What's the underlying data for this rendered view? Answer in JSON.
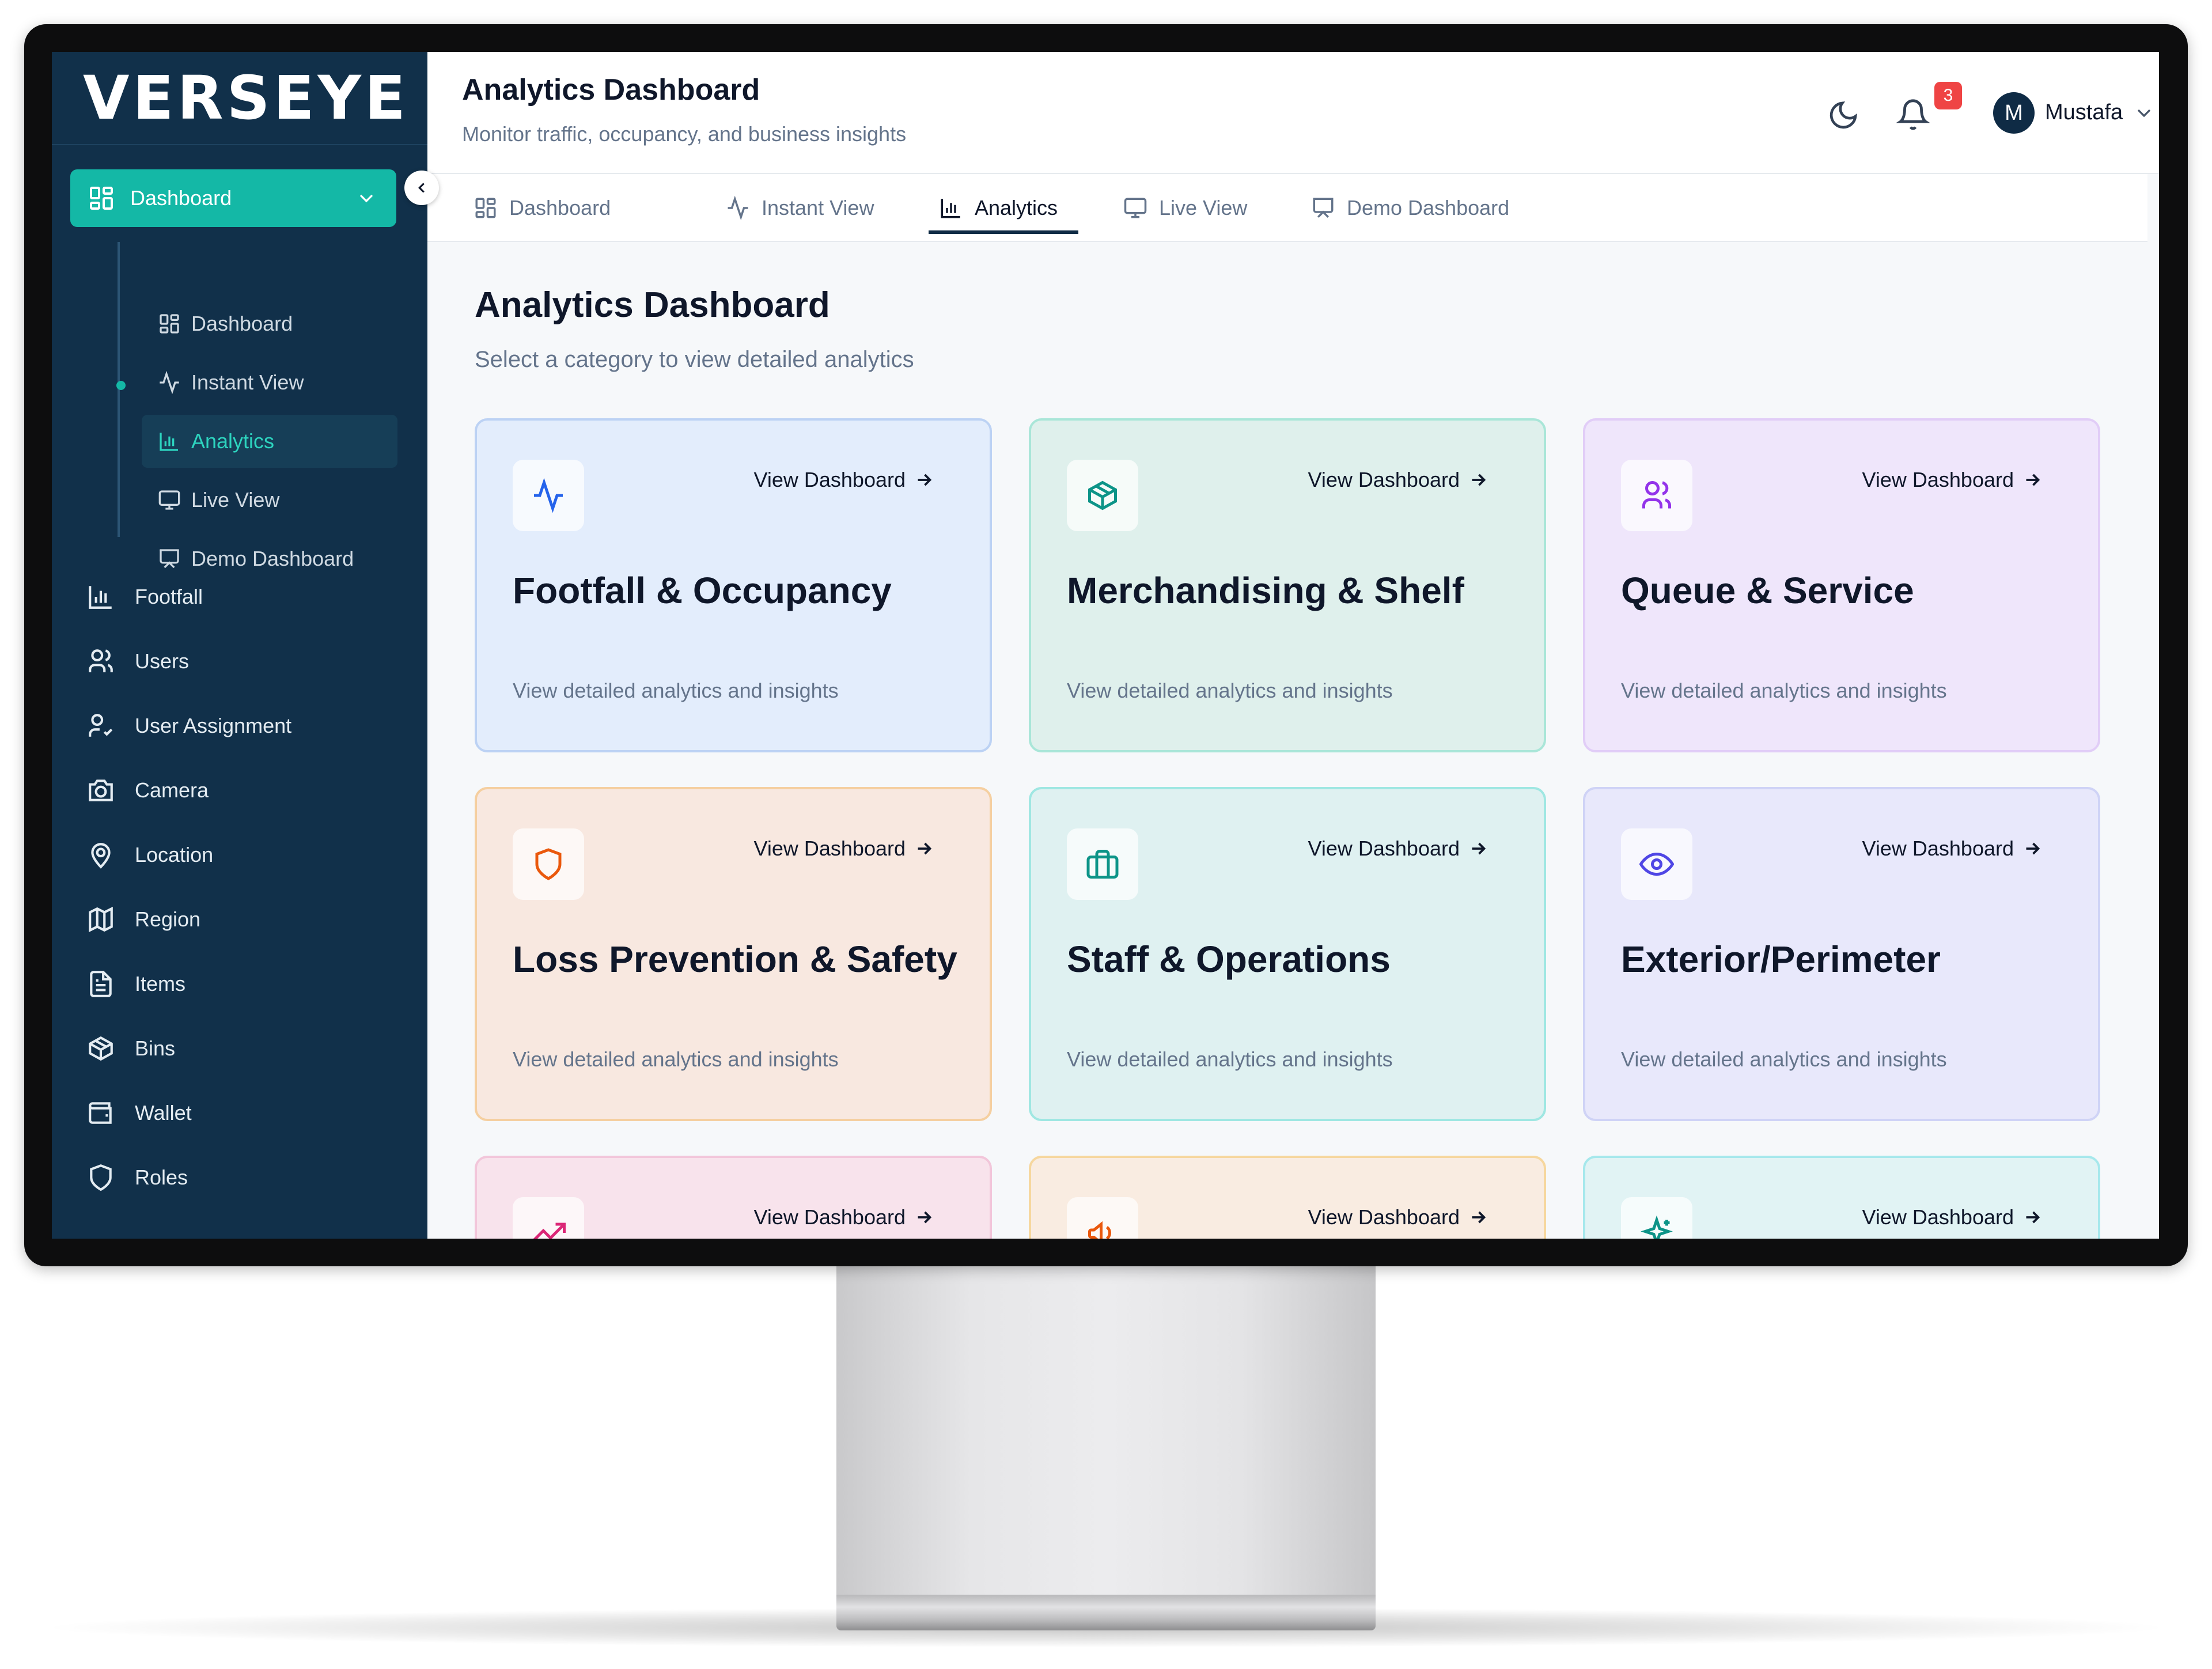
{
  "brand": {
    "logo_text": "VERSEYE"
  },
  "sidebar": {
    "main": {
      "label": "Dashboard",
      "icon": "grid-icon"
    },
    "subitems": [
      {
        "label": "Dashboard",
        "icon": "grid-icon"
      },
      {
        "label": "Instant View",
        "icon": "activity-icon"
      },
      {
        "label": "Analytics",
        "icon": "bar-chart-icon",
        "active": true
      },
      {
        "label": "Live View",
        "icon": "monitor-icon"
      },
      {
        "label": "Demo Dashboard",
        "icon": "presentation-icon"
      }
    ],
    "items": [
      {
        "label": "Footfall",
        "icon": "bar-chart-icon"
      },
      {
        "label": "Users",
        "icon": "users-icon"
      },
      {
        "label": "User Assignment",
        "icon": "user-check-icon"
      },
      {
        "label": "Camera",
        "icon": "camera-icon"
      },
      {
        "label": "Location",
        "icon": "map-pin-icon"
      },
      {
        "label": "Region",
        "icon": "map-icon"
      },
      {
        "label": "Items",
        "icon": "file-text-icon"
      },
      {
        "label": "Bins",
        "icon": "box-icon"
      },
      {
        "label": "Wallet",
        "icon": "wallet-icon"
      },
      {
        "label": "Roles",
        "icon": "shield-icon"
      }
    ]
  },
  "header": {
    "title": "Analytics Dashboard",
    "subtitle": "Monitor traffic, occupancy, and business insights",
    "notifications": "3",
    "user": {
      "initial": "M",
      "name": "Mustafa"
    }
  },
  "tabs": [
    {
      "label": "Dashboard",
      "icon": "grid-icon"
    },
    {
      "label": "Instant View",
      "icon": "activity-icon"
    },
    {
      "label": "Analytics",
      "icon": "bar-chart-icon",
      "active": true
    },
    {
      "label": "Live View",
      "icon": "monitor-icon"
    },
    {
      "label": "Demo Dashboard",
      "icon": "presentation-icon"
    }
  ],
  "main": {
    "title": "Analytics Dashboard",
    "subtitle": "Select a category to view detailed analytics",
    "cards": [
      {
        "title": "Footfall & Occupancy",
        "description": "View detailed analytics and insights",
        "link": "View Dashboard",
        "icon": "activity-icon",
        "color": "#2563eb"
      },
      {
        "title": "Merchandising & Shelf",
        "description": "View detailed analytics and insights",
        "link": "View Dashboard",
        "icon": "box-icon",
        "color": "#0d9488"
      },
      {
        "title": "Queue & Service",
        "description": "View detailed analytics and insights",
        "link": "View Dashboard",
        "icon": "users-icon",
        "color": "#9333ea"
      },
      {
        "title": "Loss Prevention & Safety",
        "description": "View detailed analytics and insights",
        "link": "View Dashboard",
        "icon": "shield-icon",
        "color": "#ea580c"
      },
      {
        "title": "Staff & Operations",
        "description": "View detailed analytics and insights",
        "link": "View Dashboard",
        "icon": "briefcase-icon",
        "color": "#0d9488"
      },
      {
        "title": "Exterior/Perimeter",
        "description": "View detailed analytics and insights",
        "link": "View Dashboard",
        "icon": "eye-icon",
        "color": "#4f46e5"
      },
      {
        "title": "",
        "description": "",
        "link": "View Dashboard",
        "icon": "trending-up-icon",
        "color": "#db2777"
      },
      {
        "title": "",
        "description": "",
        "link": "View Dashboard",
        "icon": "megaphone-icon",
        "color": "#ea580c"
      },
      {
        "title": "",
        "description": "",
        "link": "View Dashboard",
        "icon": "sparkles-icon",
        "color": "#0d9488"
      }
    ]
  }
}
